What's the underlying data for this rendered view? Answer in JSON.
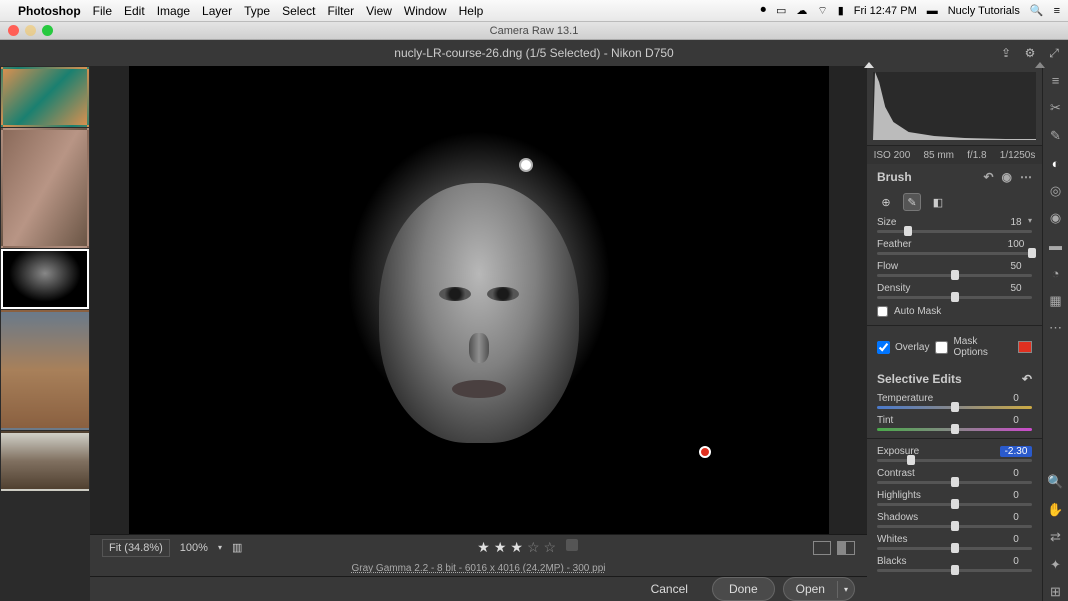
{
  "menubar": {
    "app": "Photoshop",
    "items": [
      "File",
      "Edit",
      "Image",
      "Layer",
      "Type",
      "Select",
      "Filter",
      "View",
      "Window",
      "Help"
    ],
    "clock": "Fri 12:47 PM",
    "user": "Nucly Tutorials"
  },
  "window": {
    "title": "Camera Raw 13.1"
  },
  "titlebar": {
    "title": "nucly-LR-course-26.dng (1/5 Selected)  -  Nikon D750"
  },
  "meta": {
    "iso": "ISO 200",
    "focal": "85 mm",
    "aperture": "f/1.8",
    "shutter": "1/1250s"
  },
  "brush": {
    "title": "Brush",
    "size": {
      "label": "Size",
      "value": "18",
      "pos": 20
    },
    "feather": {
      "label": "Feather",
      "value": "100",
      "pos": 100
    },
    "flow": {
      "label": "Flow",
      "value": "50",
      "pos": 50
    },
    "density": {
      "label": "Density",
      "value": "50",
      "pos": 50
    },
    "automask": "Auto Mask",
    "overlay": "Overlay",
    "maskoptions": "Mask Options"
  },
  "edits": {
    "title": "Selective Edits",
    "temperature": {
      "label": "Temperature",
      "value": "0",
      "pos": 50
    },
    "tint": {
      "label": "Tint",
      "value": "0",
      "pos": 50
    },
    "exposure": {
      "label": "Exposure",
      "value": "-2.30",
      "pos": 22
    },
    "contrast": {
      "label": "Contrast",
      "value": "0",
      "pos": 50
    },
    "highlights": {
      "label": "Highlights",
      "value": "0",
      "pos": 50
    },
    "shadows": {
      "label": "Shadows",
      "value": "0",
      "pos": 50
    },
    "whites": {
      "label": "Whites",
      "value": "0",
      "pos": 50
    },
    "blacks": {
      "label": "Blacks",
      "value": "0",
      "pos": 50
    }
  },
  "bottom": {
    "fit": "Fit (34.8%)",
    "zoom": "100%"
  },
  "info": "Gray Gamma 2.2 - 8 bit - 6016 x 4016 (24.2MP) - 300 ppi",
  "buttons": {
    "cancel": "Cancel",
    "done": "Done",
    "open": "Open"
  }
}
